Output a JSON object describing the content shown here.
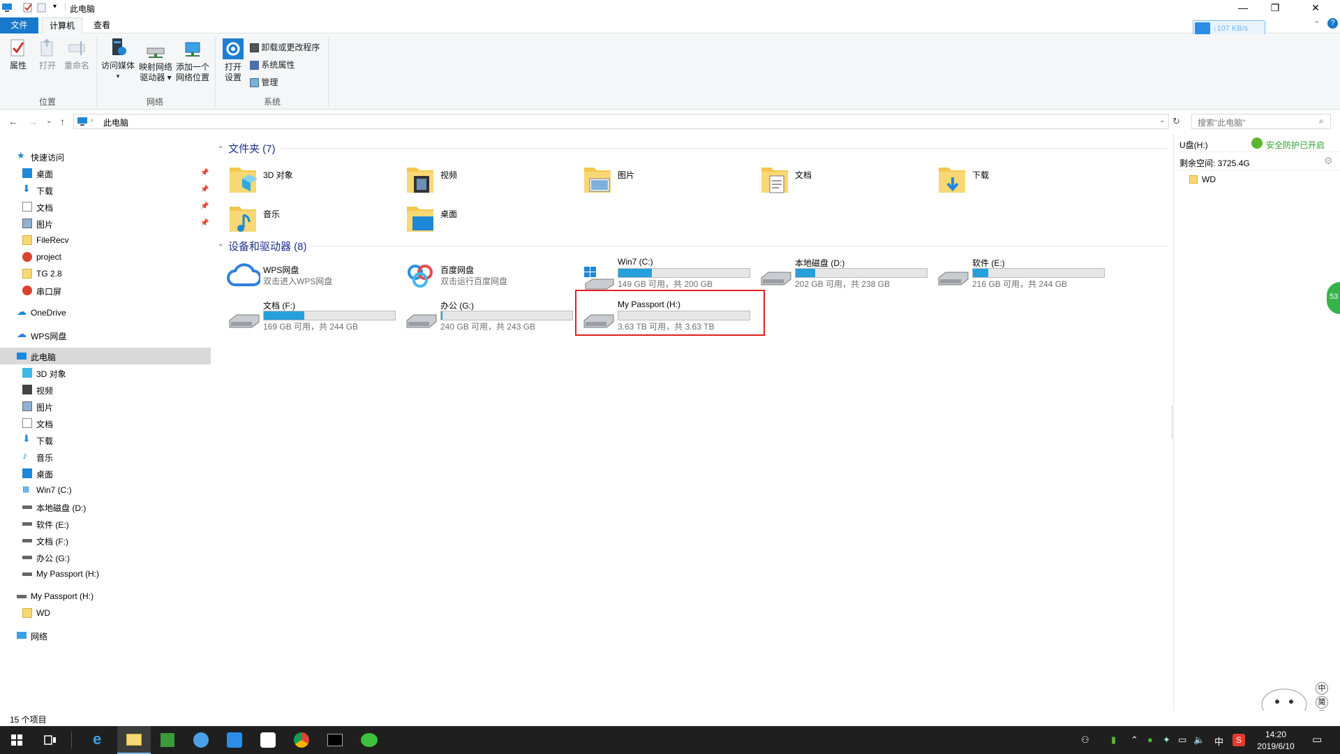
{
  "window": {
    "title": "此电脑"
  },
  "tabs": {
    "file": "文件",
    "computer": "计算机",
    "view": "查看"
  },
  "ribbon": {
    "properties": "属性",
    "open": "打开",
    "rename": "重命名",
    "group_location": "位置",
    "access_media_1": "访问媒体",
    "map_drive_1": "映射网络",
    "map_drive_2": "驱动器 ▾",
    "add_location_1": "添加一个",
    "add_location_2": "网络位置",
    "group_network": "网络",
    "open_settings_1": "打开",
    "open_settings_2": "设置",
    "uninstall": "卸载或更改程序",
    "system_props": "系统属性",
    "manage": "管理",
    "group_system": "系统"
  },
  "speed_widget": "↓107 KB/s",
  "address": {
    "path": "此电脑",
    "search_placeholder": "搜索\"此电脑\""
  },
  "leftnav": {
    "quick_access": "快速访问",
    "quick_items": [
      "桌面",
      "下载",
      "文档",
      "图片",
      "FileRecv",
      "project",
      "TG 2.8",
      "串口屏"
    ],
    "onedrive": "OneDrive",
    "wps": "WPS网盘",
    "this_pc": "此电脑",
    "pc_items": [
      "3D 对象",
      "视频",
      "图片",
      "文档",
      "下载",
      "音乐",
      "桌面",
      "Win7 (C:)",
      "本地磁盘 (D:)",
      "软件 (E:)",
      "文档 (F:)",
      "办公 (G:)",
      "My Passport (H:)"
    ],
    "passport": "My Passport (H:)",
    "wd": "WD",
    "network": "网络"
  },
  "main": {
    "folders_header": "文件夹 (7)",
    "folders": [
      "3D 对象",
      "视频",
      "图片",
      "文档",
      "下载",
      "音乐",
      "桌面"
    ],
    "drives_header": "设备和驱动器 (8)",
    "cloud": [
      {
        "name": "WPS网盘",
        "sub": "双击进入WPS网盘"
      },
      {
        "name": "百度网盘",
        "sub": "双击运行百度网盘"
      }
    ],
    "drives": [
      {
        "name": "Win7 (C:)",
        "sub": "149 GB 可用，共 200 GB",
        "used": 0.255
      },
      {
        "name": "本地磁盘 (D:)",
        "sub": "202 GB 可用，共 238 GB",
        "used": 0.151
      },
      {
        "name": "软件 (E:)",
        "sub": "216 GB 可用，共 244 GB",
        "used": 0.115
      },
      {
        "name": "文档 (F:)",
        "sub": "169 GB 可用，共 244 GB",
        "used": 0.307
      },
      {
        "name": "办公 (G:)",
        "sub": "240 GB 可用，共 243 GB",
        "used": 0.012
      },
      {
        "name": "My Passport (H:)",
        "sub": "3.63 TB 可用，共 3.63 TB",
        "used": 0.0
      }
    ]
  },
  "rightpanel": {
    "drive": "U盘(H:)",
    "protect": "安全防护已开启",
    "free": "剩余空间: 3725.4G",
    "folder": "WD",
    "badge": "53"
  },
  "status": {
    "count": "15 个项目"
  },
  "ime": [
    "中",
    "简"
  ],
  "taskbar": {
    "ime": "中",
    "time": "14:20",
    "date": "2019/6/10"
  }
}
